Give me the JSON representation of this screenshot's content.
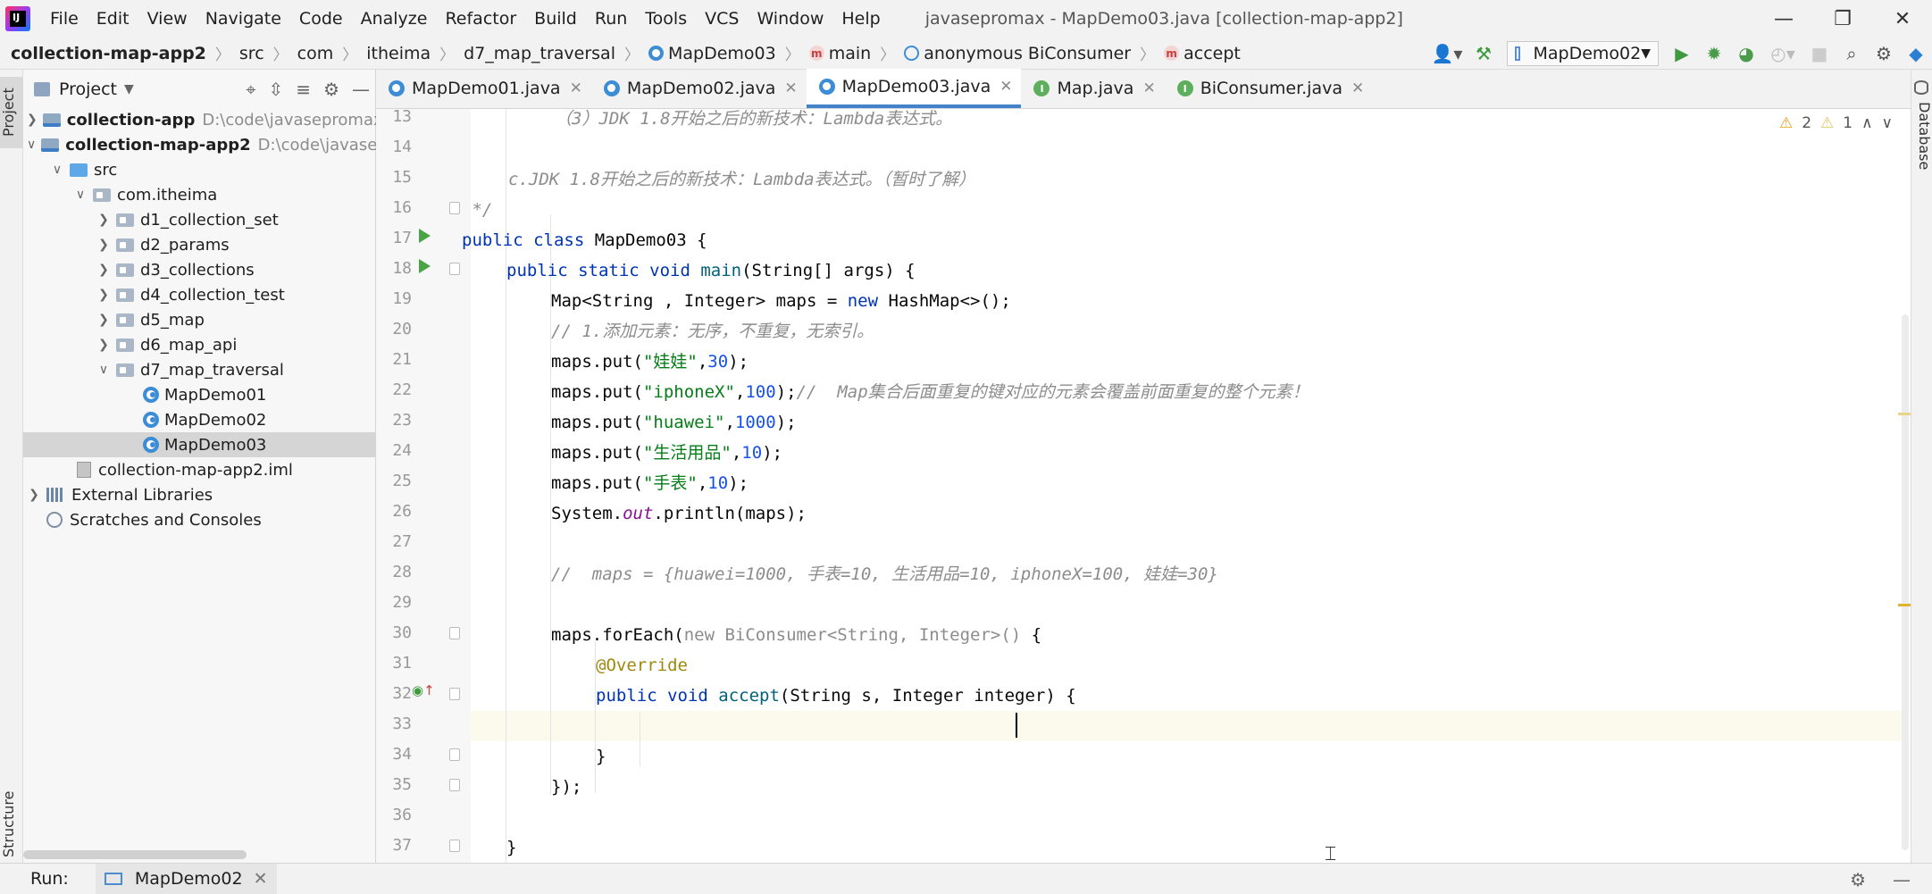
{
  "app": {
    "logo_text": "IJ",
    "window_title": "javasepromax - MapDemo03.java [collection-map-app2]"
  },
  "menu": [
    "File",
    "Edit",
    "View",
    "Navigate",
    "Code",
    "Analyze",
    "Refactor",
    "Build",
    "Run",
    "Tools",
    "VCS",
    "Window",
    "Help"
  ],
  "breadcrumb": [
    "collection-map-app2",
    "src",
    "com",
    "itheima",
    "d7_map_traversal",
    "MapDemo03",
    "main",
    "anonymous BiConsumer",
    "accept"
  ],
  "run_config": "MapDemo02",
  "side_tabs": {
    "project": "Project",
    "structure": "Structure",
    "database": "Database"
  },
  "project_panel": {
    "title": "Project",
    "tree": [
      {
        "label": "collection-app",
        "hint": "D:\\code\\javasepromax\\c",
        "bold": true
      },
      {
        "label": "collection-map-app2",
        "hint": "D:\\code\\javasepro",
        "bold": true
      },
      {
        "label": "src"
      },
      {
        "label": "com.itheima"
      },
      {
        "label": "d1_collection_set"
      },
      {
        "label": "d2_params"
      },
      {
        "label": "d3_collections"
      },
      {
        "label": "d4_collection_test"
      },
      {
        "label": "d5_map"
      },
      {
        "label": "d6_map_api"
      },
      {
        "label": "d7_map_traversal"
      },
      {
        "label": "MapDemo01"
      },
      {
        "label": "MapDemo02"
      },
      {
        "label": "MapDemo03"
      },
      {
        "label": "collection-map-app2.iml"
      },
      {
        "label": "External Libraries"
      },
      {
        "label": "Scratches and Consoles"
      }
    ]
  },
  "tabs": [
    "MapDemo01.java",
    "MapDemo02.java",
    "MapDemo03.java",
    "Map.java",
    "BiConsumer.java"
  ],
  "active_tab": "MapDemo03.java",
  "inspections": {
    "warnings": "2",
    "weak_warnings": "1"
  },
  "editor": {
    "line_numbers": [
      "13",
      "14",
      "15",
      "16",
      "17",
      "18",
      "19",
      "20",
      "21",
      "22",
      "23",
      "24",
      "25",
      "26",
      "27",
      "28",
      "29",
      "30",
      "31",
      "32",
      "33",
      "34",
      "35",
      "36",
      "37"
    ],
    "code": {
      "l13": "（3）JDK 1.8开始之后的新技术：Lambda表达式。",
      "l15": "c.JDK 1.8开始之后的新技术：Lambda表达式。（暂时了解）",
      "l16": " */",
      "l17_kw": "public class ",
      "l17_rest": "MapDemo03 {",
      "l18_kw": "public static void ",
      "l18_fn": "main",
      "l18_rest": "(String[] args) {",
      "l19_a": "Map<String , Integer> maps = ",
      "l19_kw": "new ",
      "l19_b": "HashMap<>();",
      "l20": "// 1.添加元素：无序，不重复，无索引。",
      "l21_a": "maps.put(",
      "l21_s": "\"娃娃\"",
      "l21_n": "30",
      "l22_a": "maps.put(",
      "l22_s": "\"iphoneX\"",
      "l22_n": "100",
      "l22_c": "//  Map集合后面重复的键对应的元素会覆盖前面重复的整个元素！",
      "l23_a": "maps.put(",
      "l23_s": "\"huawei\"",
      "l23_n": "1000",
      "l24_a": "maps.put(",
      "l24_s": "\"生活用品\"",
      "l24_n": "10",
      "l25_a": "maps.put(",
      "l25_s": "\"手表\"",
      "l25_n": "10",
      "l26_a": "System.",
      "l26_st": "out",
      "l26_b": ".println(maps);",
      "l28": "//  maps = {huawei=1000, 手表=10, 生活用品=10, iphoneX=100, 娃娃=30}",
      "l30_a": "maps.forEach(",
      "l30_g": "new BiConsumer<String, Integer>()",
      "l30_b": " {",
      "l31": "@Override",
      "l32_kw": "public void ",
      "l32_fn": "accept",
      "l32_rest": "(String s, Integer integer) {",
      "l34": "}",
      "l35": "});",
      "l37": "}"
    }
  },
  "runbar": {
    "label": "Run:",
    "config": "MapDemo02"
  },
  "colors": {
    "accent": "#4083c9",
    "keyword": "#0033b3",
    "string": "#067d17",
    "number": "#1750eb",
    "comment": "#8c8c8c"
  }
}
